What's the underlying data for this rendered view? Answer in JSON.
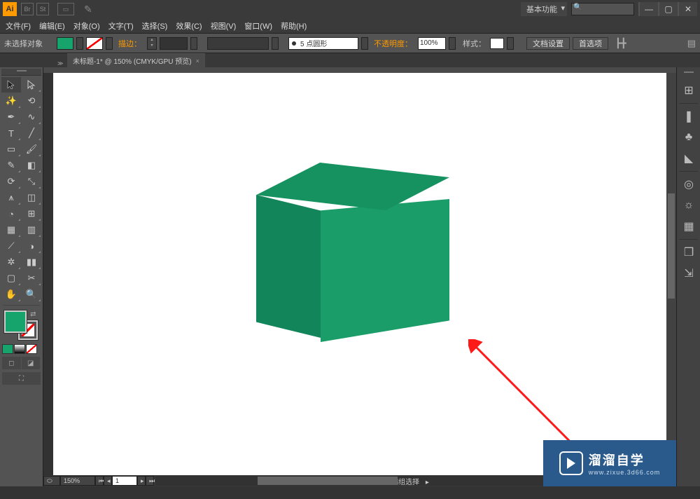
{
  "title_bar": {
    "logo": "Ai",
    "workspace": "基本功能",
    "search_placeholder": ""
  },
  "menu": [
    "文件(F)",
    "编辑(E)",
    "对象(O)",
    "文字(T)",
    "选择(S)",
    "效果(C)",
    "视图(V)",
    "窗口(W)",
    "帮助(H)"
  ],
  "options": {
    "no_selection": "未选择对象",
    "stroke_label": "描边：",
    "stroke_preset": "5 点圆形",
    "opacity_label": "不透明度：",
    "opacity_value": "100%",
    "style_label": "样式：",
    "doc_setup": "文档设置",
    "preferences": "首选项"
  },
  "tab": {
    "title": "未标题-1* @ 150% (CMYK/GPU 预览)"
  },
  "colors": {
    "fill": "#16a36c",
    "cube_top": "#15925f",
    "cube_left": "#13855a",
    "cube_right": "#1a9d68",
    "arrow": "#ff1a1a"
  },
  "status": {
    "zoom": "150%",
    "artboard": "1",
    "mode": "编组选择"
  },
  "watermark": {
    "text": "溜溜自学",
    "url": "www.zixue.3d66.com"
  }
}
